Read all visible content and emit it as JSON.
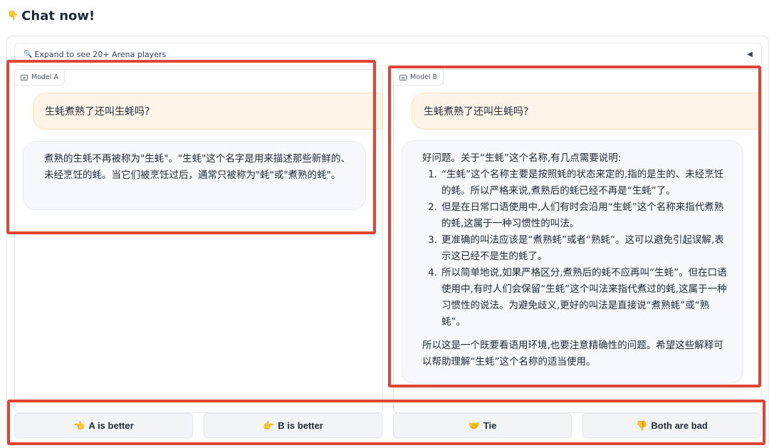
{
  "header": {
    "icon": "pointing-down-emoji",
    "emoji": "👇",
    "title": "Chat now!"
  },
  "accordion": {
    "icon": "magnifier-icon",
    "icon_glyph": "🔍",
    "label": "Expand to see 20+ Arena players",
    "caret": "◀"
  },
  "model_a": {
    "label": "Model A",
    "user_message": "生蚝煮熟了还叫生蚝吗?",
    "bot_message": "煮熟的生蚝不再被称为\"生蚝\"。\"生蚝\"这个名字是用来描述那些新鲜的、未经烹饪的蚝。当它们被烹饪过后，通常只被称为\"蚝\"或\"煮熟的蚝\"。"
  },
  "model_b": {
    "label": "Model B",
    "user_message": "生蚝煮熟了还叫生蚝吗?",
    "bot_intro": "好问题。关于“生蚝”这个名称,有几点需要说明:",
    "bot_points": [
      {
        "num": "1.",
        "text": "“生蚝”这个名称主要是按照蚝的状态来定的,指的是生的、未经烹饪的蚝。所以严格来说,煮熟后的蚝已经不再是“生蚝”了。"
      },
      {
        "num": "2.",
        "text": "但是在日常口语使用中,人们有时会沿用“生蚝”这个名称来指代煮熟的蚝,这属于一种习惯性的叫法。"
      },
      {
        "num": "3.",
        "text": "更准确的叫法应该是“煮熟蚝”或者“熟蚝”。这可以避免引起误解,表示这已经不是生的蚝了。"
      },
      {
        "num": "4.",
        "text": "所以简单地说,如果严格区分,煮熟后的蚝不应再叫“生蚝”。但在口语使用中,有时人们会保留“生蚝”这个叫法来指代煮过的蚝,这属于一种习惯性的说法。为避免歧义,更好的叫法是直接说“煮熟蚝”或“熟蚝”。"
      }
    ],
    "bot_outro": "所以这是一个既要看语用环境,也要注意精确性的问题。希望这些解释可以帮助理解“生蚝”这个名称的适当使用。"
  },
  "vote_buttons": [
    {
      "emoji": "👈",
      "label": "A is better"
    },
    {
      "emoji": "👉",
      "label": "B is better"
    },
    {
      "emoji": "🤝",
      "label": "Tie"
    },
    {
      "emoji": "👎",
      "label": "Both are bad"
    }
  ],
  "colors": {
    "highlight": "#e04434",
    "user_bubble": "#fef5e8",
    "bot_bubble": "#f7f8fb",
    "button_bg": "#f3f4f6"
  }
}
